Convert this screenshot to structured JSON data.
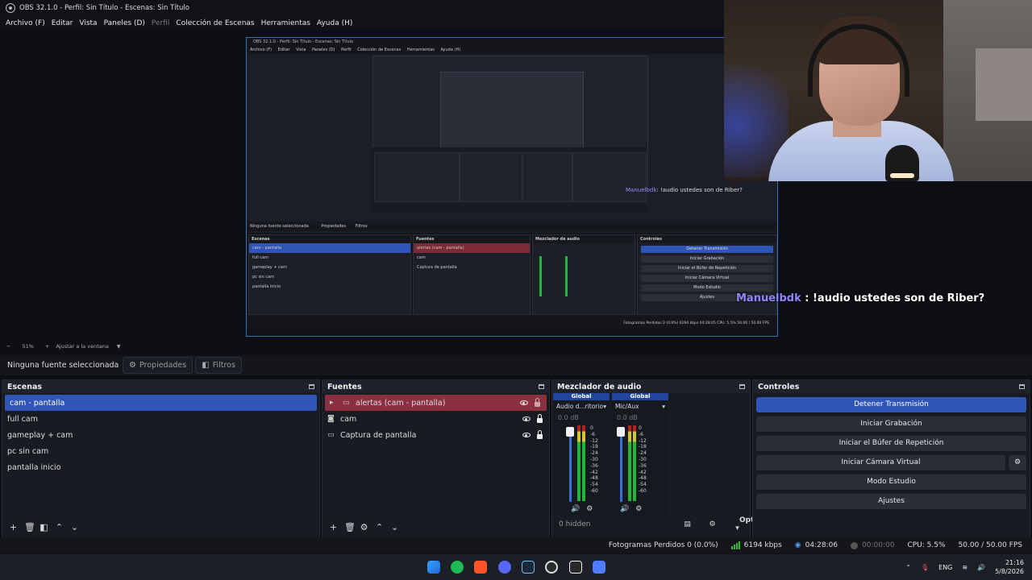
{
  "window": {
    "title": "OBS 32.1.0 - Perfil: Sin Título - Escenas: Sin Título"
  },
  "menu": [
    {
      "label": "Archivo (F)",
      "enabled": true
    },
    {
      "label": "Editar",
      "enabled": true
    },
    {
      "label": "Vista",
      "enabled": true
    },
    {
      "label": "Paneles (D)",
      "enabled": true
    },
    {
      "label": "Perfil",
      "enabled": false
    },
    {
      "label": "Colección de Escenas",
      "enabled": true
    },
    {
      "label": "Herramientas",
      "enabled": true
    },
    {
      "label": "Ayuda (H)",
      "enabled": true
    }
  ],
  "nested_preview": {
    "title": "OBS 32.1.0 - Perfil: Sin Título - Escenas: Sin Título",
    "menu": [
      "Archivo (F)",
      "Editar",
      "Vista",
      "Paneles (D)",
      "Perfil",
      "Colección de Escenas",
      "Herramientas",
      "Ayuda (H)"
    ],
    "no_source": "Ninguna fuente seleccionada",
    "props": "Propiedades",
    "filters": "Filtros",
    "scenes_title": "Escenas",
    "scenes": [
      "cam - pantalla",
      "full cam",
      "gameplay + cam",
      "pc sin cam",
      "pantalla inicio"
    ],
    "sources_title": "Fuentes",
    "sources": [
      "alertas (cam - pantalla)",
      "cam",
      "Captura de pantalla"
    ],
    "mixer_title": "Mezclador de audio",
    "controls_title": "Controles",
    "controls": [
      "Detener Transmisión",
      "Iniciar Grabación",
      "Iniciar el Búfer de Repetición",
      "Iniciar Cámara Virtual",
      "Modo Estudio",
      "Ajustes"
    ],
    "status": "Fotogramas Perdidos 0 (0.0%)   6194 kbps   04:28:05   CPU: 5.5%   50.00 / 50.00 FPS",
    "chat_user": "Manuelbdk",
    "chat_text": ": !audio ustedes son de Riber?"
  },
  "chat_overlay": {
    "user": "Manuelbdk",
    "text": " : !audio ustedes son de Riber?"
  },
  "zoom": {
    "minus": "−",
    "percent": "51%",
    "plus": "+",
    "fit": "Ajustar a la ventana"
  },
  "properties_bar": {
    "no_source": "Ninguna fuente seleccionada",
    "properties": "Propiedades",
    "filters": "Filtros"
  },
  "scenes": {
    "title": "Escenas",
    "items": [
      "cam - pantalla",
      "full cam",
      "gameplay + cam",
      "pc sin cam",
      "pantalla inicio"
    ],
    "selected_index": 0
  },
  "sources": {
    "title": "Fuentes",
    "items": [
      {
        "label": "alertas (cam - pantalla)",
        "icon": "folder-icon",
        "selected": true
      },
      {
        "label": "cam",
        "icon": "camera-icon",
        "selected": false
      },
      {
        "label": "Captura de pantalla",
        "icon": "monitor-icon",
        "selected": false
      }
    ]
  },
  "mixer": {
    "title": "Mezclador de audio",
    "channels": [
      {
        "scope": "Global",
        "device": "Audio d...ritorio",
        "db": "0.0 dB"
      },
      {
        "scope": "Global",
        "device": "Mic/Aux",
        "db": "0.0 dB"
      }
    ],
    "ticks": [
      "0",
      "-6",
      "-12",
      "-18",
      "-24",
      "-30",
      "-36",
      "-42",
      "-48",
      "-54",
      "-60"
    ],
    "hidden": "0 hidden",
    "options": "Options"
  },
  "controls": {
    "title": "Controles",
    "stop_stream": "Detener Transmisión",
    "start_recording": "Iniciar Grabación",
    "replay_buffer": "Iniciar el Búfer de Repetición",
    "virtual_cam": "Iniciar Cámara Virtual",
    "studio_mode": "Modo Estudio",
    "settings": "Ajustes"
  },
  "status": {
    "dropped": "Fotogramas Perdidos 0 (0.0%)",
    "bitrate": "6194 kbps",
    "stream_time": "04:28:06",
    "rec_time": "00:00:00",
    "cpu": "CPU: 5.5%",
    "fps": "50.00 / 50.00 FPS"
  },
  "taskbar": {
    "lang": "ENG",
    "time": "21:16",
    "date": "5/8/2026",
    "apps": [
      "windows-start-icon",
      "spotify-icon",
      "brave-icon",
      "discord-icon",
      "steam-icon",
      "obs-icon",
      "epic-icon",
      "app-icon"
    ]
  },
  "colors": {
    "accent": "#2f55b8",
    "selected_source": "#8a3040",
    "chat_user": "#8e86ff"
  }
}
